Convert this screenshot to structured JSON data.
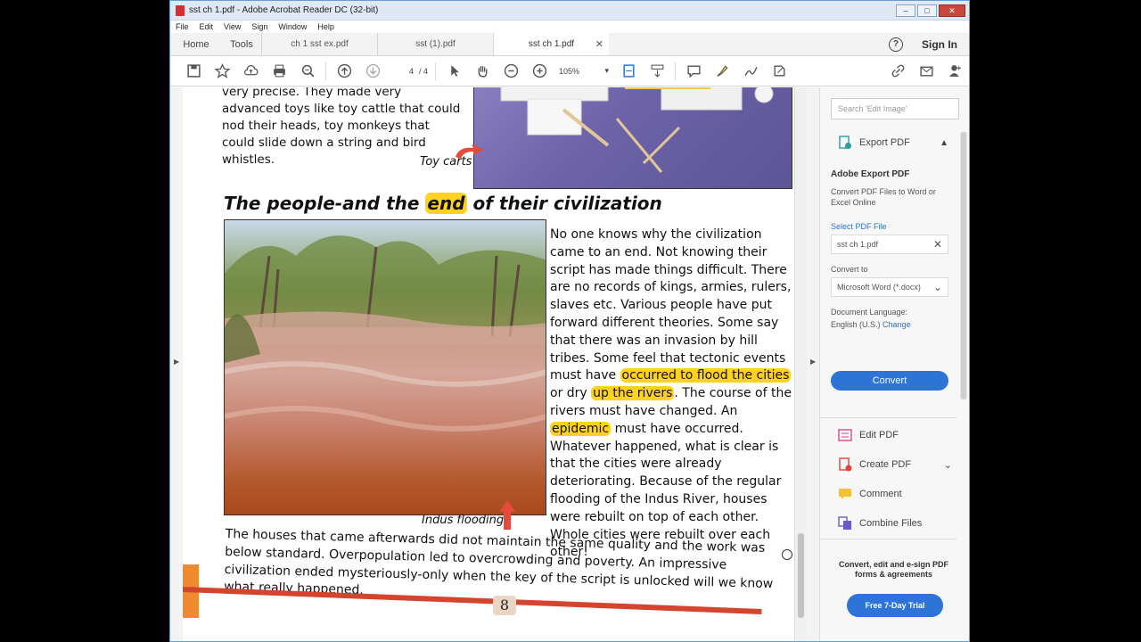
{
  "window": {
    "title": "sst ch 1.pdf - Adobe Acrobat Reader DC (32-bit)"
  },
  "menu": [
    "File",
    "Edit",
    "View",
    "Sign",
    "Window",
    "Help"
  ],
  "tabs": {
    "home": "Home",
    "tools": "Tools",
    "docs": [
      {
        "label": "ch 1 sst ex.pdf"
      },
      {
        "label": "sst (1).pdf"
      },
      {
        "label": "sst ch 1.pdf",
        "active": true
      }
    ],
    "sign_in": "Sign In"
  },
  "toolbar": {
    "page_current": "4",
    "page_total": "/ 4",
    "zoom": "105%"
  },
  "document": {
    "intro": "very precise. They made very advanced toys like toy cattle that could nod their heads, toy monkeys that could slide down a string and bird whistles.",
    "toy_caption": "Toy carts",
    "heading_pre": "The people-and the ",
    "heading_hl": "end",
    "heading_post": " of their civilization",
    "body_1": "No one knows why the civilization came to an end. Not knowing their script has made things difficult. There are no records of kings, armies, rulers, slaves etc. Various people have put forward different theories. Some say that there was an invasion by hill tribes. Some feel that tectonic events must have ",
    "body_hl1": "occurred to flood the cities",
    "body_2": " or dry ",
    "body_hl2": "up the rivers",
    "body_3": ". The course of the rivers must have changed. An ",
    "body_hl3": "epidemic",
    "body_4": " must have occurred. Whatever happened, what is clear is that the cities were already deteriorating. Because of the regular flooding of the Indus River, houses were rebuilt on top of each other. Whole cities were rebuilt over each other!",
    "flood_caption": "Indus flooding",
    "bottom": "The houses that came afterwards did not maintain the same quality and the work was below standard. Overpopulation led to overcrowding and poverty. An impressive civilization ended mysteriously-only when the key of the script is unlocked will we know what really happened.",
    "page_number": "8"
  },
  "right_pane": {
    "search_placeholder": "Search 'Edit Image'",
    "export_header": "Export PDF",
    "export_title": "Adobe Export PDF",
    "export_desc": "Convert PDF Files to Word or Excel Online",
    "select_label": "Select PDF File",
    "selected_file": "sst ch 1.pdf",
    "convert_to_label": "Convert to",
    "convert_to_value": "Microsoft Word (*.docx)",
    "doc_lang_label": "Document Language:",
    "doc_lang_value": "English (U.S.)",
    "change_link": "Change",
    "convert_btn": "Convert",
    "tools": [
      "Edit PDF",
      "Create PDF",
      "Comment",
      "Combine Files"
    ],
    "promo": "Convert, edit and e-sign PDF forms & agreements",
    "trial_btn": "Free 7-Day Trial"
  },
  "colors": {
    "accent": "#2d73d8",
    "highlight": "#ffd21f",
    "close": "#c9463d"
  }
}
